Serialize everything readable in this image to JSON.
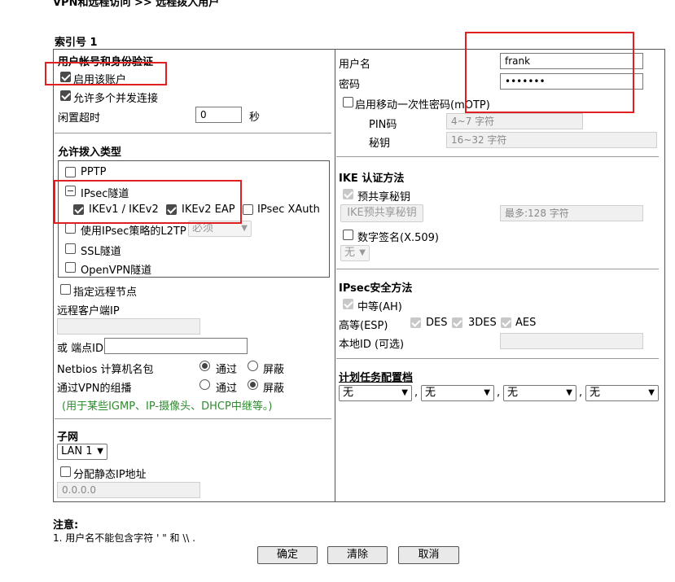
{
  "breadcrumb": "VPN和远程访问 >> 远程拨入用户",
  "index_label": "索引号 1",
  "account": {
    "header": "用户帐号和身份验证",
    "enable_label": "启用该账户",
    "multi_conn_label": "允许多个并发连接",
    "idle_label": "闲置超时",
    "idle_value": "0",
    "idle_unit": "秒"
  },
  "dialin": {
    "header": "允许拨入类型",
    "pptp": "PPTP",
    "ipsec": "IPsec隧道",
    "ikev1": "IKEv1 / IKEv2",
    "ikev2eap": "IKEv2 EAP",
    "xauth": "IPsec XAuth",
    "l2tp": "使用IPsec策略的L2TP",
    "l2tp_select": "必须",
    "ssl": "SSL隧道",
    "openvpn": "OpenVPN隧道"
  },
  "remote": {
    "specify_label": "指定远程节点",
    "client_ip_label": "远程客户端IP",
    "client_ip_value": "",
    "peer_id_label": "或 端点ID",
    "peer_id_value": "",
    "netbios_label": "Netbios 计算机名包",
    "group_label": "通过VPN的组播",
    "pass_label": "通过",
    "block_label": "屏蔽",
    "note": "(用于某些IGMP、IP-摄像头、DHCP中继等。)"
  },
  "subnet": {
    "header": "子网",
    "lan_value": "LAN 1",
    "static_ip_label": "分配静态IP地址",
    "static_ip_value": "0.0.0.0"
  },
  "login": {
    "username_label": "用户名",
    "username_value": "frank",
    "password_label": "密码",
    "password_value": "•••••••",
    "motp_label": "启用移动一次性密码(mOTP)",
    "pin_label": "PIN码",
    "pin_placeholder": "4~7 字符",
    "secret_label": "秘钥",
    "secret_placeholder": "16~32 字符"
  },
  "ike": {
    "header": "IKE 认证方法",
    "psk_label": "预共享秘钥",
    "psk_button": "IKE预共享秘钥",
    "psk_placeholder": "最多:128 字符",
    "cert_label": "数字签名(X.509)",
    "cert_select": "无"
  },
  "ipsec_sec": {
    "header": "IPsec安全方法",
    "ah_label": "中等(AH)",
    "esp_label": "高等(ESP)",
    "des": "DES",
    "tdes": "3DES",
    "aes": "AES",
    "local_id_label": "本地ID (可选)",
    "local_id_value": ""
  },
  "schedule": {
    "header": "计划任务配置档",
    "values": [
      "无",
      "无",
      "无",
      "无"
    ],
    "separator": ","
  },
  "notes": {
    "title": "注意:",
    "line1": "1. 用户名不能包含字符 ' \" 和 \\\\ ."
  },
  "buttons": {
    "ok": "确定",
    "clear": "清除",
    "cancel": "取消"
  },
  "colors": {
    "highlight": "#e02020",
    "note_green": "#2e8b2e"
  }
}
